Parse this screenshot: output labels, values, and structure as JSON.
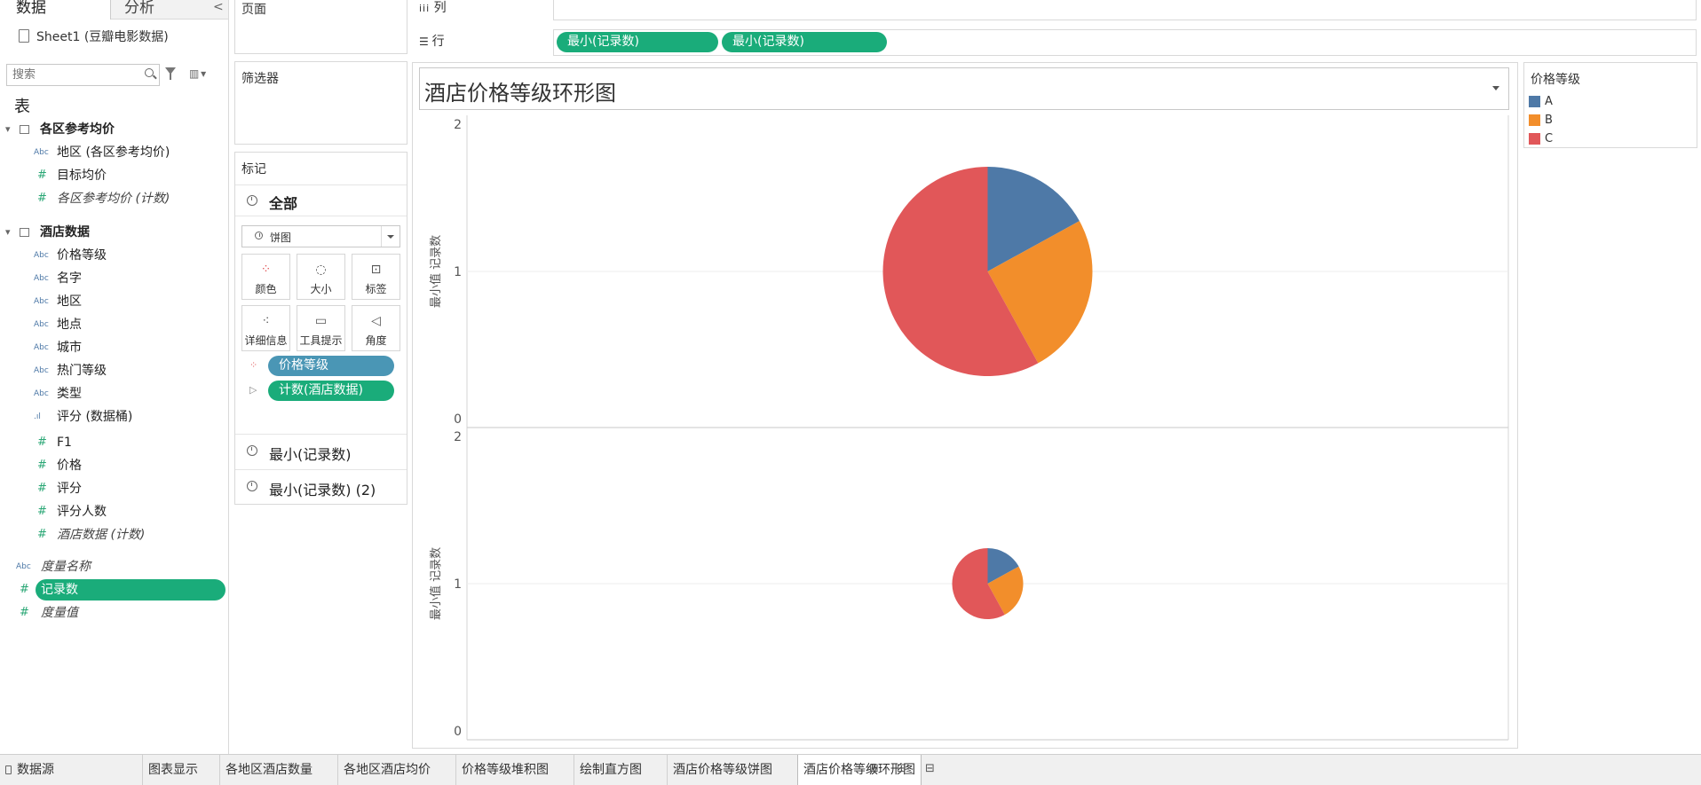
{
  "data_pane": {
    "tabs": [
      "数据",
      "分析"
    ],
    "collapse_glyph": "<",
    "datasource": "Sheet1 (豆瓣电影数据)",
    "search_placeholder": "搜索",
    "section_title": "表",
    "groups": [
      {
        "name": "各区参考均价",
        "fields": [
          {
            "type": "Abc",
            "label": "地区 (各区参考均价)",
            "italic": false
          },
          {
            "type": "#",
            "label": "目标均价",
            "italic": false
          },
          {
            "type": "#",
            "label": "各区参考均价 (计数)",
            "italic": true
          }
        ]
      },
      {
        "name": "酒店数据",
        "fields": [
          {
            "type": "Abc",
            "label": "价格等级",
            "italic": false
          },
          {
            "type": "Abc",
            "label": "名字",
            "italic": false
          },
          {
            "type": "Abc",
            "label": "地区",
            "italic": false
          },
          {
            "type": "Abc",
            "label": "地点",
            "italic": false
          },
          {
            "type": "Abc",
            "label": "城市",
            "italic": false
          },
          {
            "type": "Abc",
            "label": "热门等级",
            "italic": false
          },
          {
            "type": "Abc",
            "label": "类型",
            "italic": false
          },
          {
            "type": "bins",
            "label": "评分 (数据桶)",
            "italic": false
          },
          {
            "type": "#",
            "label": "F1",
            "italic": false
          },
          {
            "type": "#",
            "label": "价格",
            "italic": false
          },
          {
            "type": "#",
            "label": "评分",
            "italic": false
          },
          {
            "type": "#",
            "label": "评分人数",
            "italic": false
          },
          {
            "type": "#",
            "label": "酒店数据 (计数)",
            "italic": true
          }
        ]
      }
    ],
    "extra_fields": [
      {
        "type": "Abc",
        "label": "度量名称",
        "italic": true
      },
      {
        "type": "#",
        "label": "记录数",
        "italic": false,
        "selected": true
      },
      {
        "type": "#",
        "label": "度量值",
        "italic": true
      }
    ]
  },
  "cards": {
    "pages": "页面",
    "filters": "筛选器",
    "marks": {
      "title": "标记",
      "all": "全部",
      "mark_type": "饼图",
      "buttons": [
        "颜色",
        "大小",
        "标签",
        "详细信息",
        "工具提示",
        "角度"
      ],
      "pills": [
        {
          "label": "价格等级",
          "kind": "dimension"
        },
        {
          "label": "计数(酒店数据)",
          "kind": "measure"
        }
      ],
      "sub_cards": [
        "最小(记录数)",
        "最小(记录数) (2)"
      ]
    }
  },
  "shelves": {
    "columns_label": "列",
    "rows_label": "行",
    "rows_pills": [
      "最小(记录数)",
      "最小(记录数)"
    ]
  },
  "view": {
    "title": "酒店价格等级环形图",
    "axis_label": "最小值 记录数"
  },
  "legend": {
    "title": "价格等级",
    "items": [
      {
        "label": "A",
        "color": "#4e79a7"
      },
      {
        "label": "B",
        "color": "#f28e2b"
      },
      {
        "label": "C",
        "color": "#e15759"
      }
    ]
  },
  "chart_data": [
    {
      "type": "pie",
      "title": "酒店价格等级环形图",
      "ylabel": "最小值 记录数",
      "ylim": [
        0,
        2
      ],
      "yticks": [
        0,
        1,
        2
      ],
      "y": 1,
      "categories": [
        "A",
        "B",
        "C"
      ],
      "values": [
        0.17,
        0.25,
        0.58
      ],
      "colors": [
        "#4e79a7",
        "#f28e2b",
        "#e15759"
      ]
    },
    {
      "type": "pie",
      "title": "",
      "ylabel": "最小值 记录数",
      "ylim": [
        0,
        2
      ],
      "yticks": [
        0,
        1,
        2
      ],
      "y": 1,
      "categories": [
        "A",
        "B",
        "C"
      ],
      "values": [
        0.17,
        0.25,
        0.58
      ],
      "colors": [
        "#4e79a7",
        "#f28e2b",
        "#e15759"
      ]
    }
  ],
  "bottom_tabs": {
    "datasource": "数据源",
    "sheets": [
      "图表显示",
      "各地区酒店数量",
      "各地区酒店均价",
      "价格等级堆积图",
      "绘制直方图",
      "酒店价格等级饼图",
      "酒店价格等级环形图"
    ],
    "active": "酒店价格等级环形图"
  }
}
